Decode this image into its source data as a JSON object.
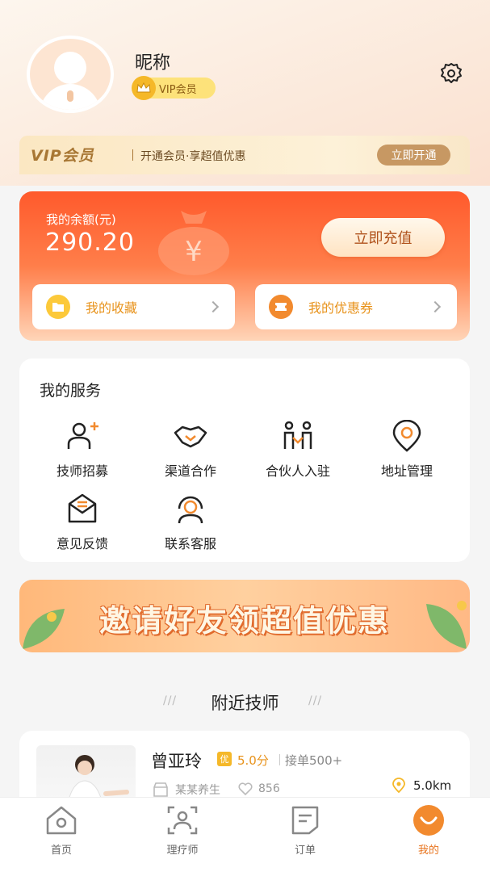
{
  "profile": {
    "nickname": "昵称",
    "vip_badge": "VIP会员"
  },
  "vip_bar": {
    "title": "VIP会员",
    "desc": "开通会员·享超值优惠",
    "button": "立即开通"
  },
  "balance": {
    "label": "我的余额(元)",
    "value": "290.20",
    "recharge_button": "立即充值",
    "shortcuts": [
      {
        "label": "我的收藏",
        "icon": "folder-icon"
      },
      {
        "label": "我的优惠券",
        "icon": "coupon-icon"
      }
    ]
  },
  "services": {
    "title": "我的服务",
    "items": [
      {
        "label": "技师招募",
        "icon": "add-user-icon"
      },
      {
        "label": "渠道合作",
        "icon": "handshake-icon"
      },
      {
        "label": "合伙人入驻",
        "icon": "partners-icon"
      },
      {
        "label": "地址管理",
        "icon": "location-icon"
      },
      {
        "label": "意见反馈",
        "icon": "feedback-icon"
      },
      {
        "label": "联系客服",
        "icon": "headset-icon"
      }
    ]
  },
  "banner": {
    "text": "邀请好友领超值优惠"
  },
  "nearby": {
    "title": "附近技师",
    "technicians": [
      {
        "name": "曾亚玲",
        "tag": "优",
        "score": "5.0分",
        "orders": "接单500+",
        "shop": "某某养生",
        "likes": "856",
        "distance": "5.0km"
      }
    ]
  },
  "tabbar": {
    "items": [
      {
        "label": "首页",
        "icon": "home-icon"
      },
      {
        "label": "理疗师",
        "icon": "therapist-icon"
      },
      {
        "label": "订单",
        "icon": "order-icon"
      },
      {
        "label": "我的",
        "icon": "smile-icon",
        "active": true
      }
    ]
  },
  "colors": {
    "accent": "#e8731c",
    "balance_card": "#ff5a2c",
    "vip_gold": "#c79863"
  }
}
